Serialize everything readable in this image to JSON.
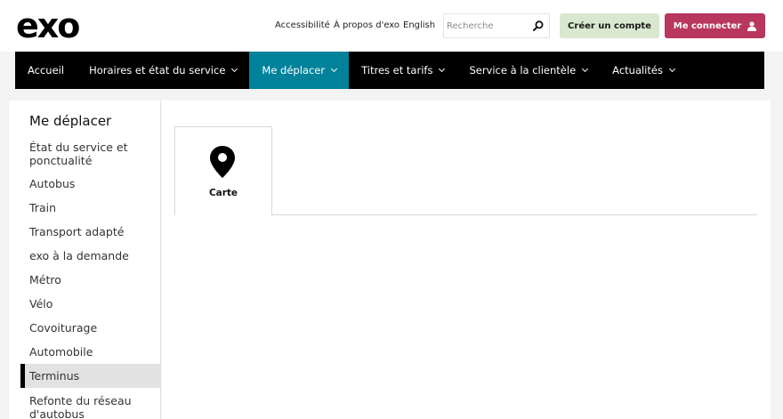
{
  "header": {
    "logo": "exo",
    "links": [
      "Accessibilité",
      "À propos d'exo",
      "English"
    ],
    "search": {
      "placeholder": "Recherche",
      "value": ""
    },
    "create_account": "Créer un compte",
    "login": "Me connecter"
  },
  "nav": {
    "items": [
      {
        "label": "Accueil",
        "dropdown": false
      },
      {
        "label": "Horaires et état du service",
        "dropdown": true
      },
      {
        "label": "Me déplacer",
        "dropdown": true,
        "active": true
      },
      {
        "label": "Titres et tarifs",
        "dropdown": true
      },
      {
        "label": "Service à la clientèle",
        "dropdown": true
      },
      {
        "label": "Actualités",
        "dropdown": true
      }
    ]
  },
  "sidebar": {
    "title": "Me déplacer",
    "items": [
      "État du service et ponctualité",
      "Autobus",
      "Train",
      "Transport adapté",
      "exo à la demande",
      "Métro",
      "Vélo",
      "Covoiturage",
      "Automobile",
      "Terminus",
      "Refonte du réseau d'autobus"
    ],
    "active_item": "Terminus"
  },
  "main": {
    "tabs": [
      {
        "label": "Carte",
        "icon": "map-pin-icon"
      }
    ]
  },
  "colors": {
    "nav_bg": "#000000",
    "nav_active": "#00829b",
    "create_button": "#d9e8cf",
    "login_button": "#b8375e"
  }
}
